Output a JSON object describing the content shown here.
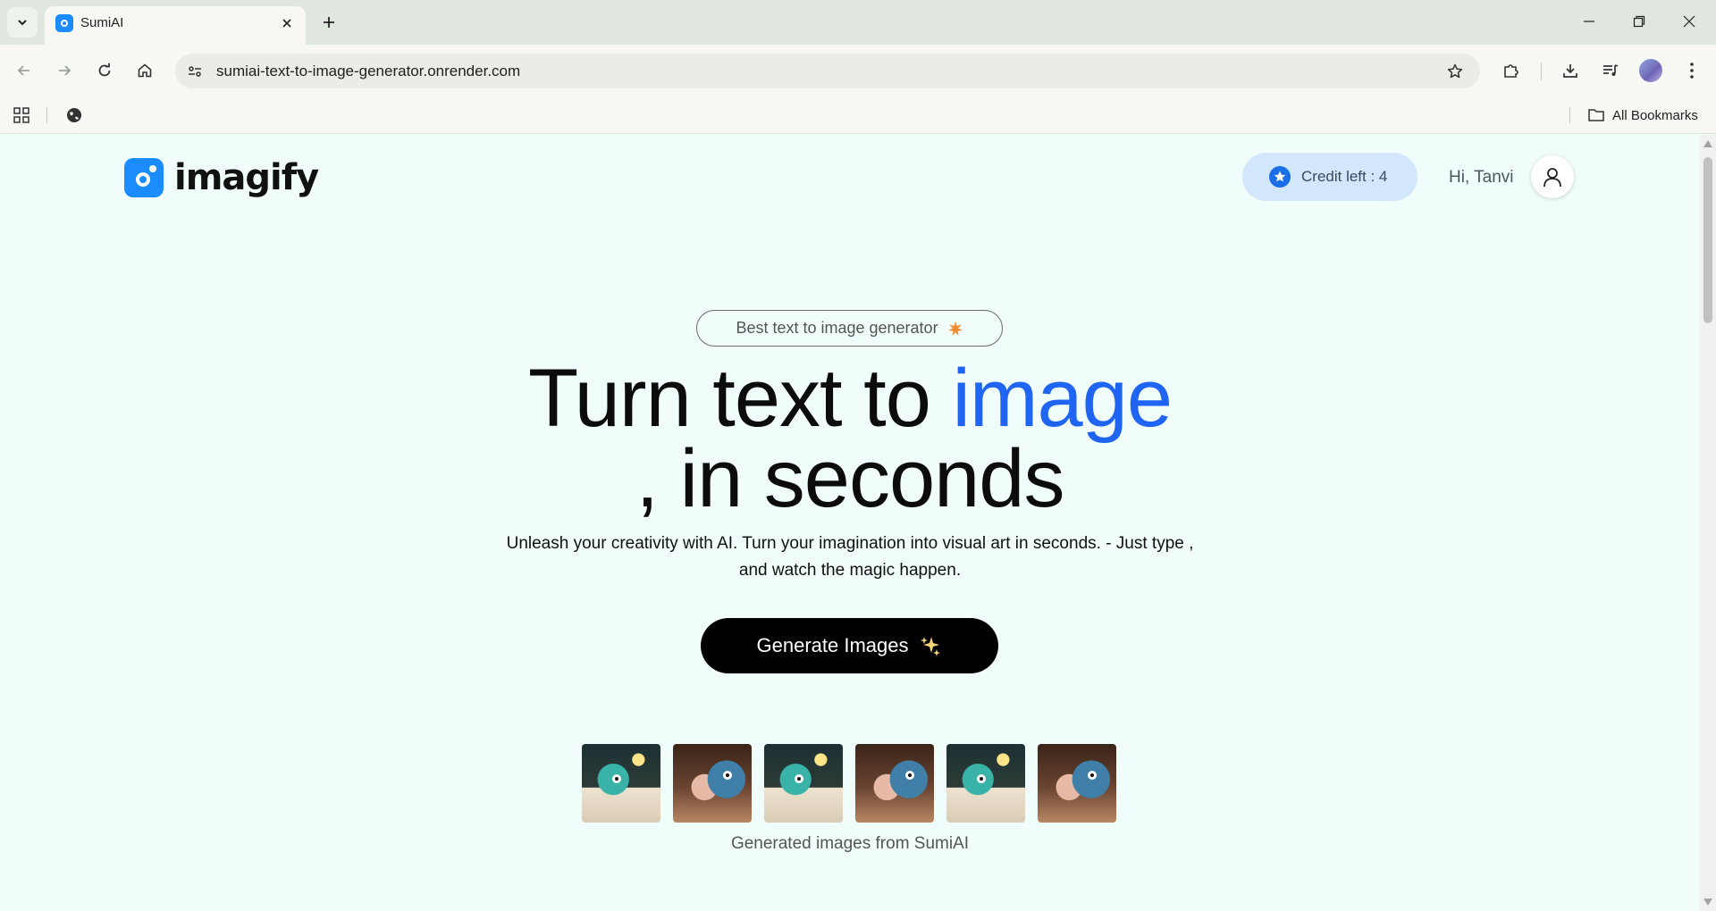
{
  "browser": {
    "tab_title": "SumiAI",
    "url": "sumiai-text-to-image-generator.onrender.com",
    "all_bookmarks_label": "All Bookmarks"
  },
  "header": {
    "logo_text": "imagify",
    "credit_label": "Credit left : 4",
    "greeting": "Hi, Tanvi"
  },
  "hero": {
    "badge_text": "Best text to image generator",
    "badge_icon": "star-burst-icon",
    "title_part1": "Turn text to ",
    "title_accent": "image",
    "title_line2": ", in seconds",
    "subtitle": "Unleash your creativity with AI. Turn your imagination into visual art in seconds. - Just type , and watch the magic happen.",
    "cta_label": "Generate Images",
    "cta_icon": "sparkles-icon",
    "accent_color": "#1f64f2"
  },
  "gallery": {
    "images": [
      "monster-at-desk",
      "monster-with-cake",
      "monster-at-desk",
      "monster-with-cake",
      "monster-at-desk",
      "monster-with-cake"
    ],
    "caption": "Generated images from SumiAI"
  }
}
